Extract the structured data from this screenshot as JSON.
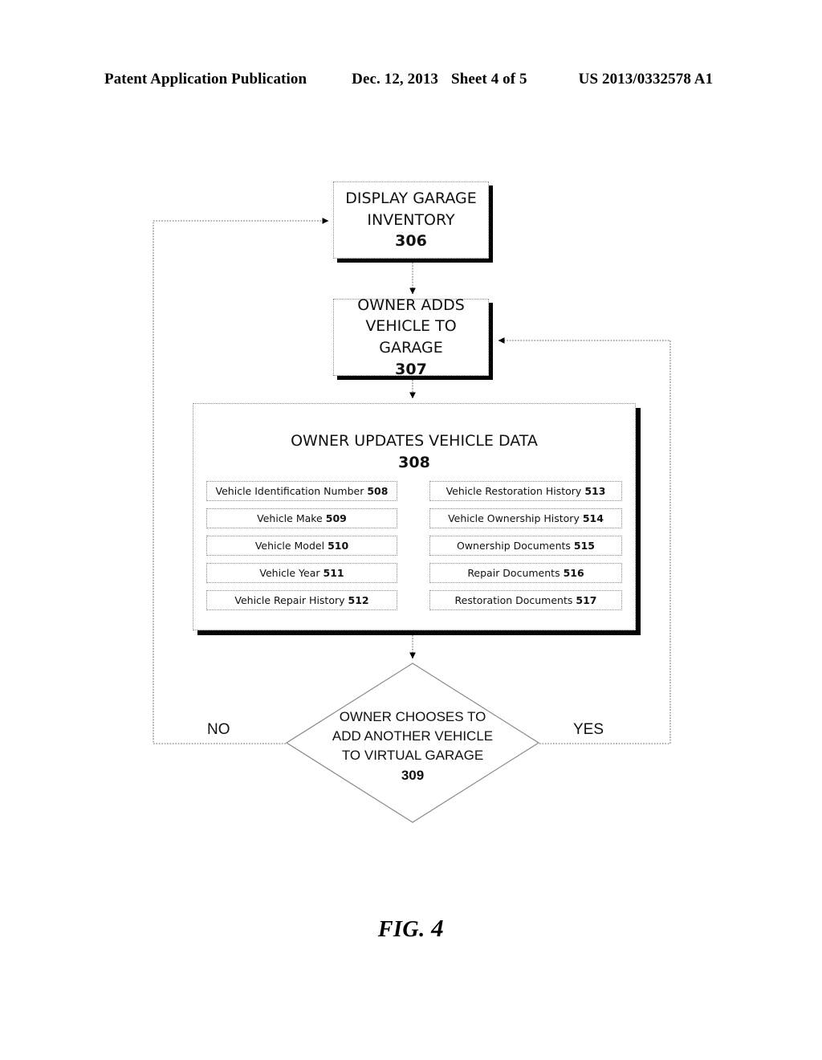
{
  "header": {
    "publication": "Patent Application Publication",
    "date": "Dec. 12, 2013",
    "sheet": "Sheet 4 of 5",
    "number": "US 2013/0332578 A1"
  },
  "figure": {
    "caption_prefix": "FIG.",
    "caption_number": "4"
  },
  "flow": {
    "box_display_inventory": {
      "line1": "DISPLAY GARAGE",
      "line2": "INVENTORY",
      "ref": "306"
    },
    "box_owner_adds": {
      "line1": "OWNER ADDS",
      "line2": "VEHICLE TO GARAGE",
      "ref": "307"
    },
    "box_owner_updates": {
      "title": "OWNER UPDATES VEHICLE DATA",
      "ref": "308",
      "fields_left": [
        {
          "label": "Vehicle Identification Number",
          "ref": "508"
        },
        {
          "label": "Vehicle Make",
          "ref": "509"
        },
        {
          "label": "Vehicle Model",
          "ref": "510"
        },
        {
          "label": "Vehicle Year ",
          "ref": "511"
        },
        {
          "label": "Vehicle Repair History",
          "ref": "512"
        }
      ],
      "fields_right": [
        {
          "label": "Vehicle Restoration History",
          "ref": "513"
        },
        {
          "label": "Vehicle Ownership History",
          "ref": "514"
        },
        {
          "label": "Ownership Documents",
          "ref": "515"
        },
        {
          "label": "Repair Documents",
          "ref": "516"
        },
        {
          "label": "Restoration Documents ",
          "ref": "517"
        }
      ]
    },
    "decision": {
      "line1": "OWNER CHOOSES TO",
      "line2": "ADD ANOTHER VEHICLE",
      "line3": "TO VIRTUAL GARAGE",
      "ref": "309"
    },
    "branch_no": "NO",
    "branch_yes": "YES"
  },
  "colors": {
    "ink": "#000000",
    "border": "#8a8a8a",
    "paper": "#ffffff"
  }
}
